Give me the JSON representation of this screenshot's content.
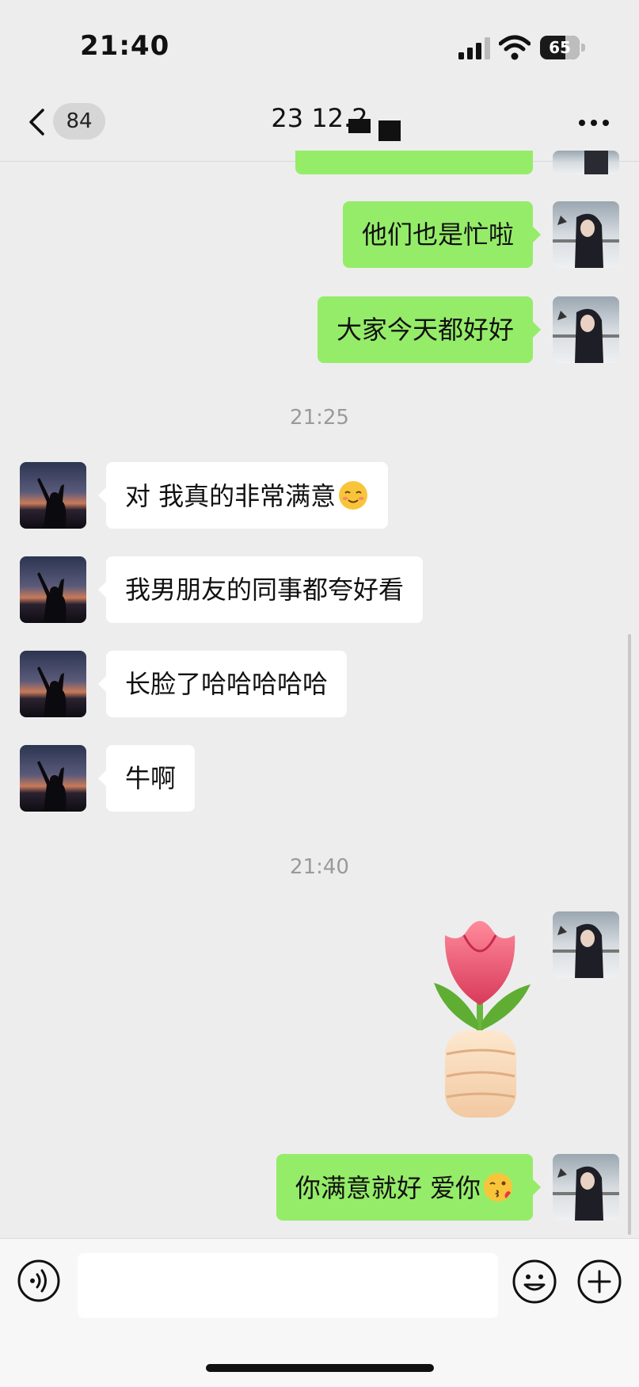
{
  "status_bar": {
    "time": "21:40",
    "battery_level": "65"
  },
  "nav": {
    "unread_count": "84",
    "title": "23 12.2"
  },
  "messages": [
    {
      "text": "他们也是忙啦",
      "from": "me"
    },
    {
      "text": "大家今天都好好",
      "from": "me"
    },
    {
      "text": "21:25",
      "type": "timestamp"
    },
    {
      "text": "对 我真的非常满意",
      "from": "them",
      "emoji": "shy-smile-emoji"
    },
    {
      "text": "我男朋友的同事都夸好看",
      "from": "them"
    },
    {
      "text": "长脸了哈哈哈哈哈",
      "from": "them"
    },
    {
      "text": "牛啊",
      "from": "them"
    },
    {
      "text": "21:40",
      "type": "timestamp"
    },
    {
      "type": "sticker",
      "from": "me",
      "sticker": "rose-in-fist-sticker"
    },
    {
      "text": "你满意就好 爱你",
      "from": "me",
      "emoji": "kiss-wink-emoji"
    }
  ],
  "input_bar": {
    "voice_icon": "voice-icon",
    "emoji_icon": "emoji-icon",
    "plus_icon": "plus-icon"
  },
  "colors": {
    "my_bubble": "#95ec69",
    "their_bubble": "#ffffff",
    "background": "#ededed"
  }
}
